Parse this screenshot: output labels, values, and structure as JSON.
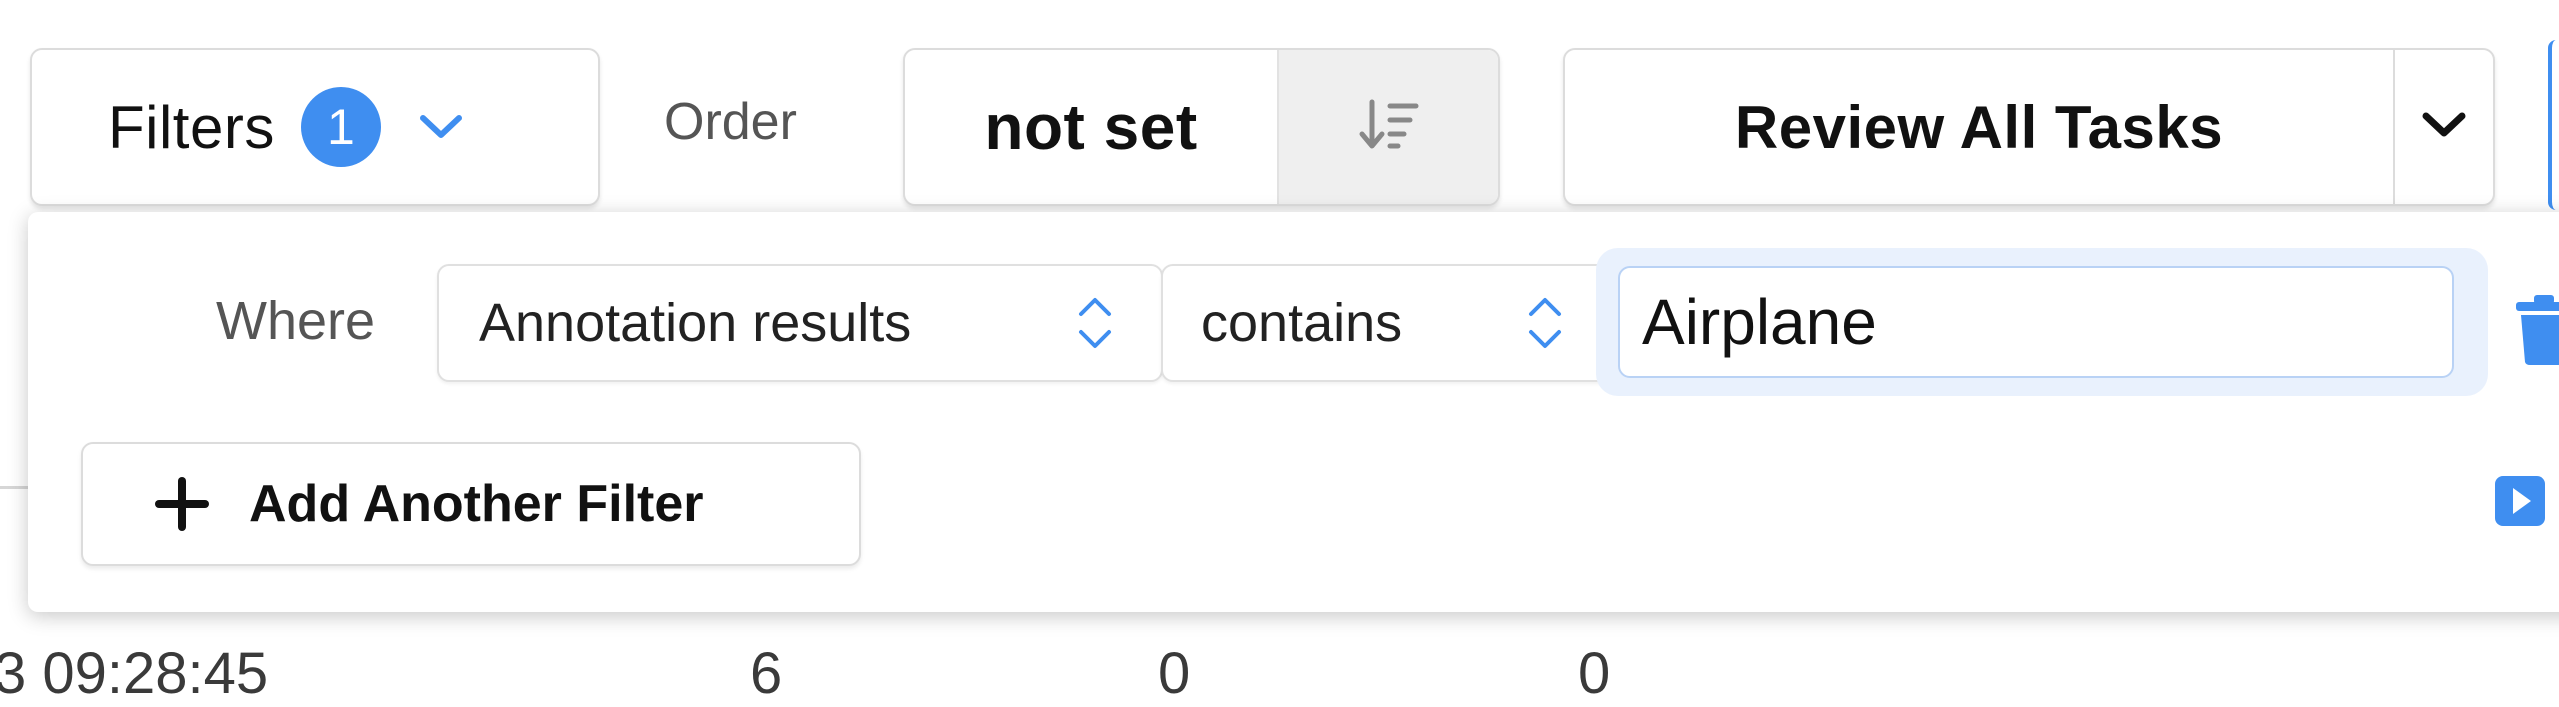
{
  "toolbar": {
    "filters_label": "Filters",
    "filters_count": "1",
    "order_label": "Order",
    "order_value": "not set",
    "review_label": "Review All Tasks"
  },
  "filter_panel": {
    "where_label": "Where",
    "rows": [
      {
        "field": "Annotation results",
        "operator": "contains",
        "value": "Airplane"
      }
    ],
    "add_filter_label": "Add Another Filter"
  },
  "background_row": {
    "cells": [
      "3 09:28:45",
      "6",
      "0",
      "0"
    ]
  },
  "icons": {
    "filters_dropdown": "chevron-down-icon",
    "sort_direction": "sort-descending-icon",
    "review_dropdown": "chevron-down-icon",
    "field_select": "up-down-chevron-icon",
    "operator_select": "up-down-chevron-icon",
    "delete_filter": "trash-icon",
    "add_filter": "plus-icon",
    "panel_toggle": "play-square-icon"
  },
  "colors": {
    "accent": "#3f8ef0",
    "badge_bg": "#3f8ef0",
    "input_focus": "#b9d2f5",
    "trash": "#3f8ef0"
  }
}
